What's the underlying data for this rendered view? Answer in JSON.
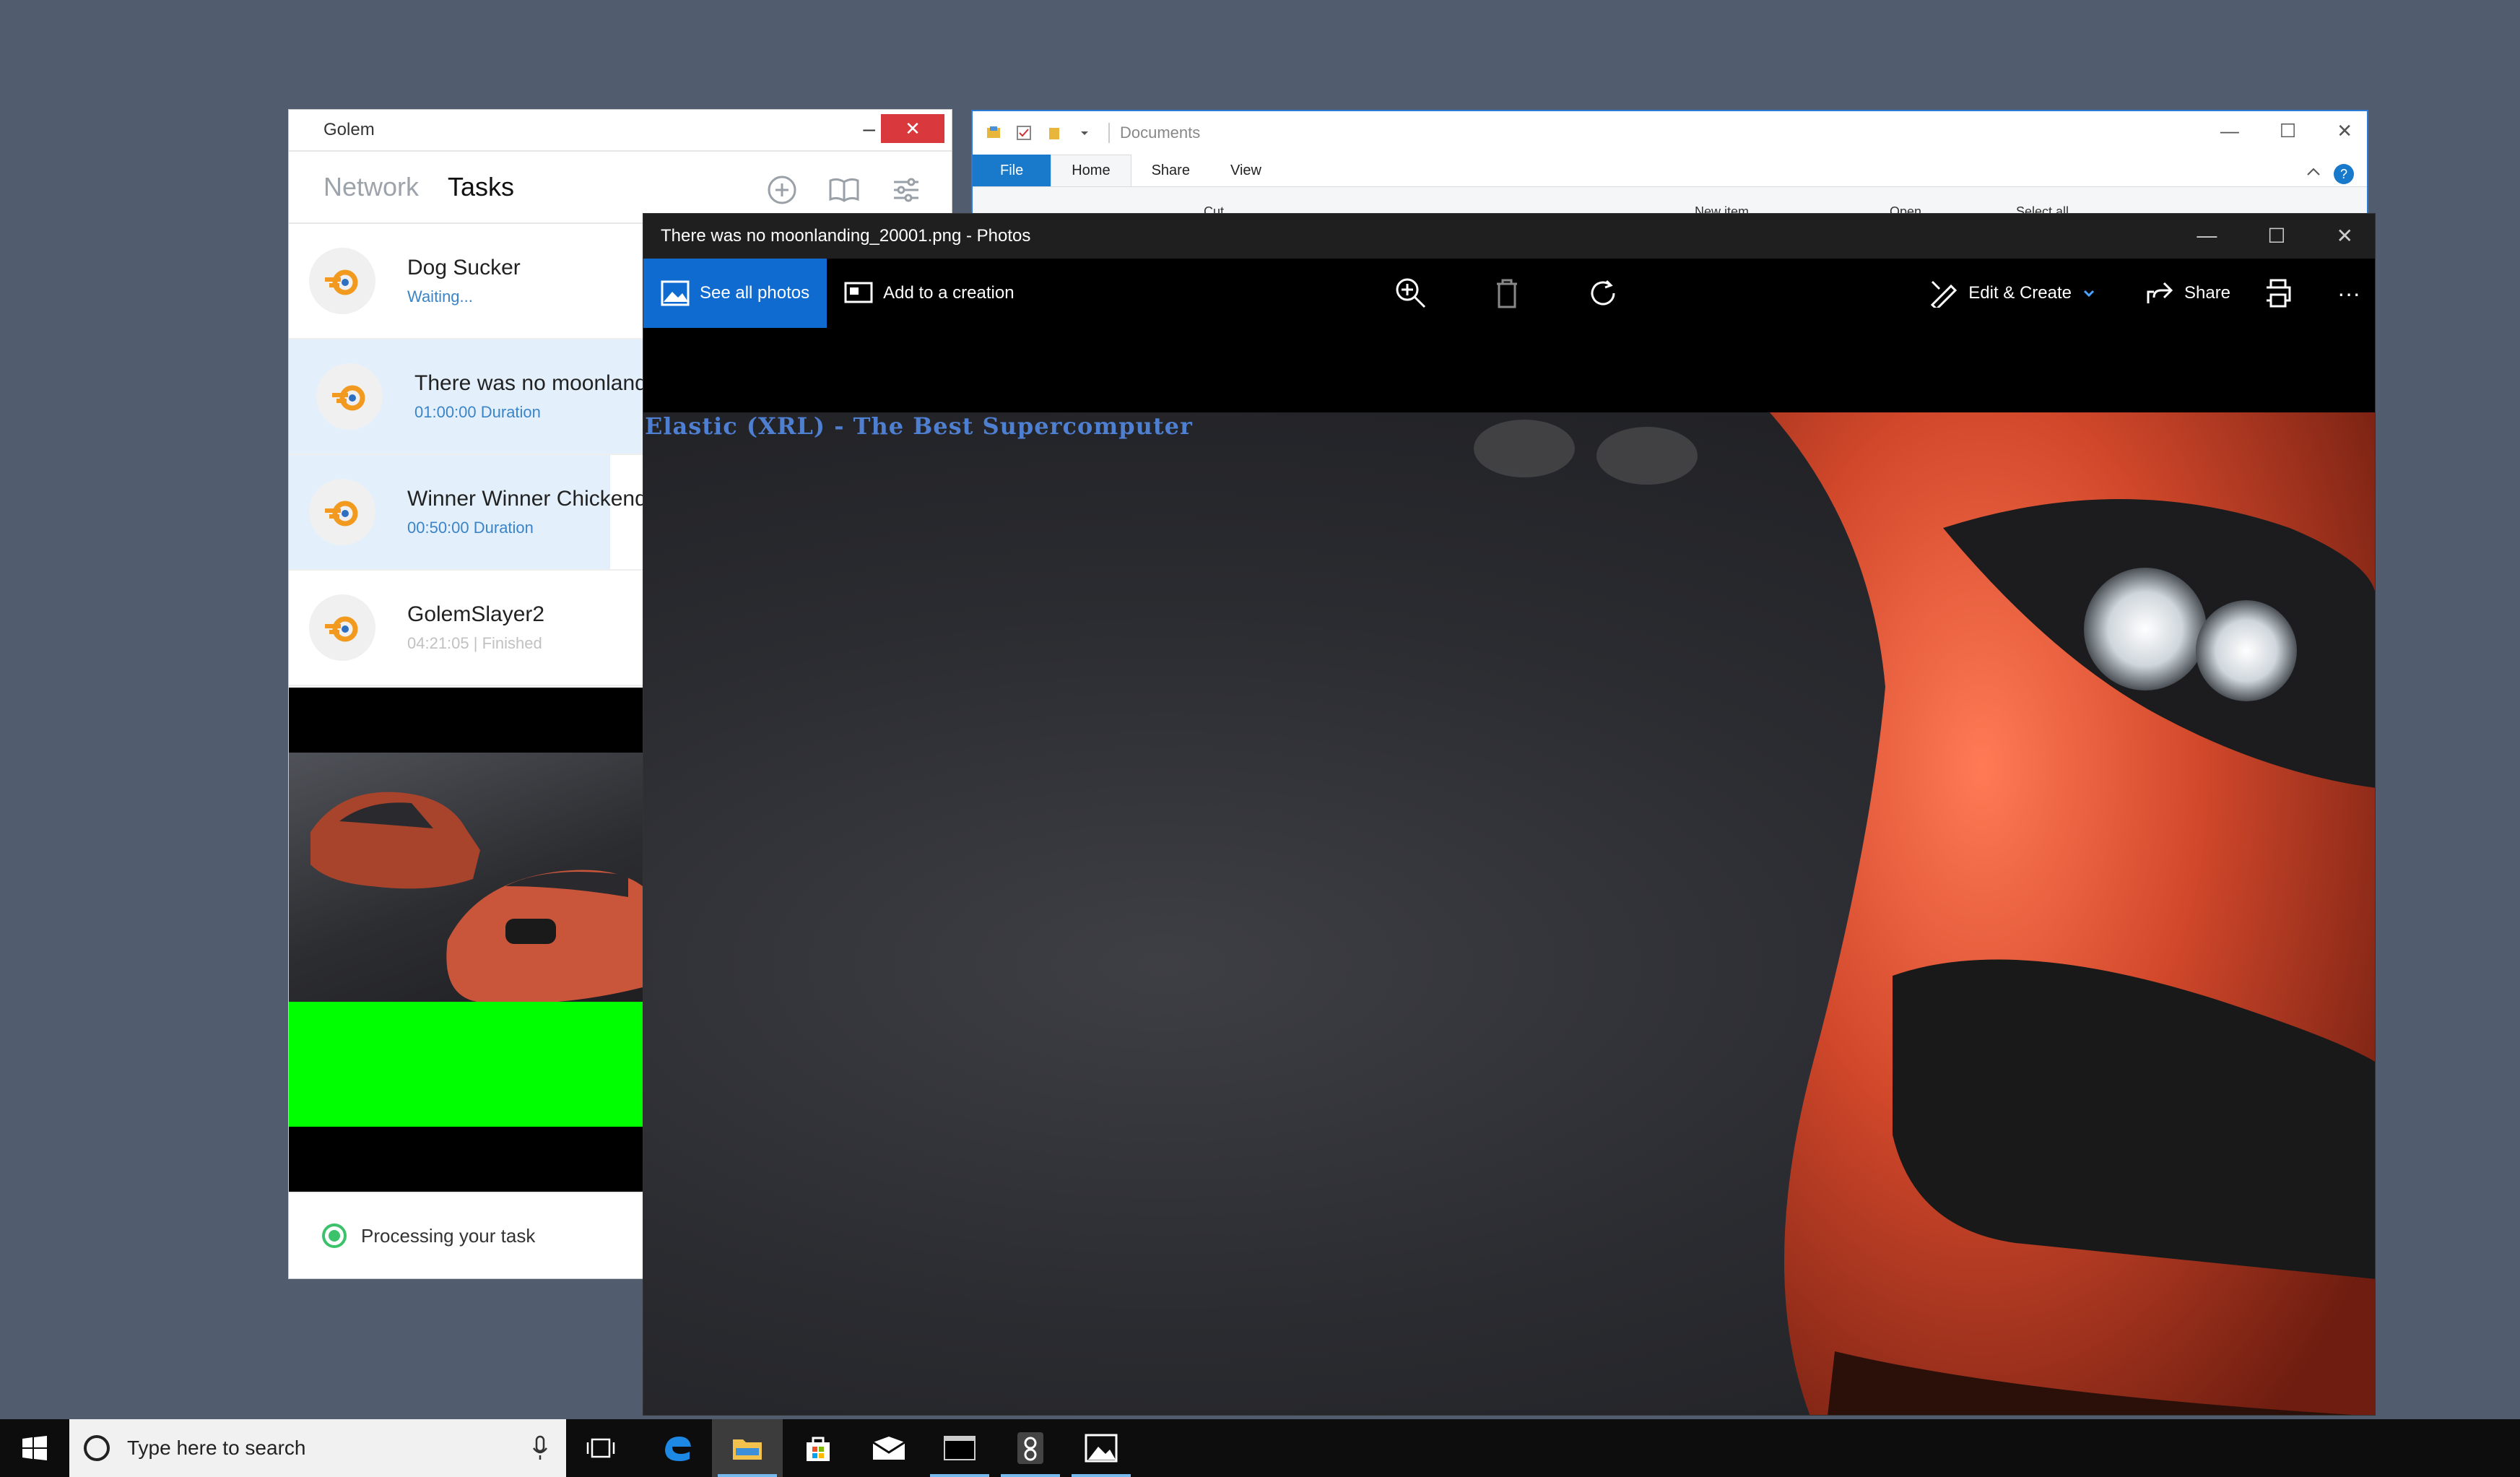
{
  "explorer": {
    "title": "Documents",
    "tabs": [
      "File",
      "Home",
      "Share",
      "View"
    ],
    "ribbon_partial": [
      "Cut",
      "New item",
      "Open",
      "Select all"
    ],
    "help_label": "?"
  },
  "golem": {
    "title": "Golem",
    "tabs": {
      "network": "Network",
      "tasks": "Tasks"
    },
    "tasks": [
      {
        "name": "Dog Sucker",
        "status": "Waiting..."
      },
      {
        "name": "There was no moonland",
        "status": "01:00:00 Duration"
      },
      {
        "name": "Winner Winner Chickendi",
        "status": "00:50:00 Duration"
      },
      {
        "name": "GolemSlayer2",
        "status": "04:21:05 | Finished"
      }
    ],
    "status_text": "Processing your task"
  },
  "photos": {
    "title": "There was no moonlanding_20001.png - Photos",
    "see_all": "See all photos",
    "add_creation": "Add to a creation",
    "edit_create": "Edit & Create",
    "share": "Share",
    "overlay_text": "Elastic (XRL) - The Best Supercomputer"
  },
  "taskbar": {
    "search_placeholder": "Type here to search",
    "apps": [
      "edge-icon",
      "file-explorer-icon",
      "store-icon",
      "mail-icon",
      "terminal-icon",
      "golem-icon",
      "photos-icon"
    ]
  },
  "colors": {
    "desktop": "#515d6e",
    "accent_blue": "#0f6bd0",
    "golem_close": "#d9393d",
    "green_block": "#00ff00",
    "task_status_blue": "#3b84c8"
  }
}
